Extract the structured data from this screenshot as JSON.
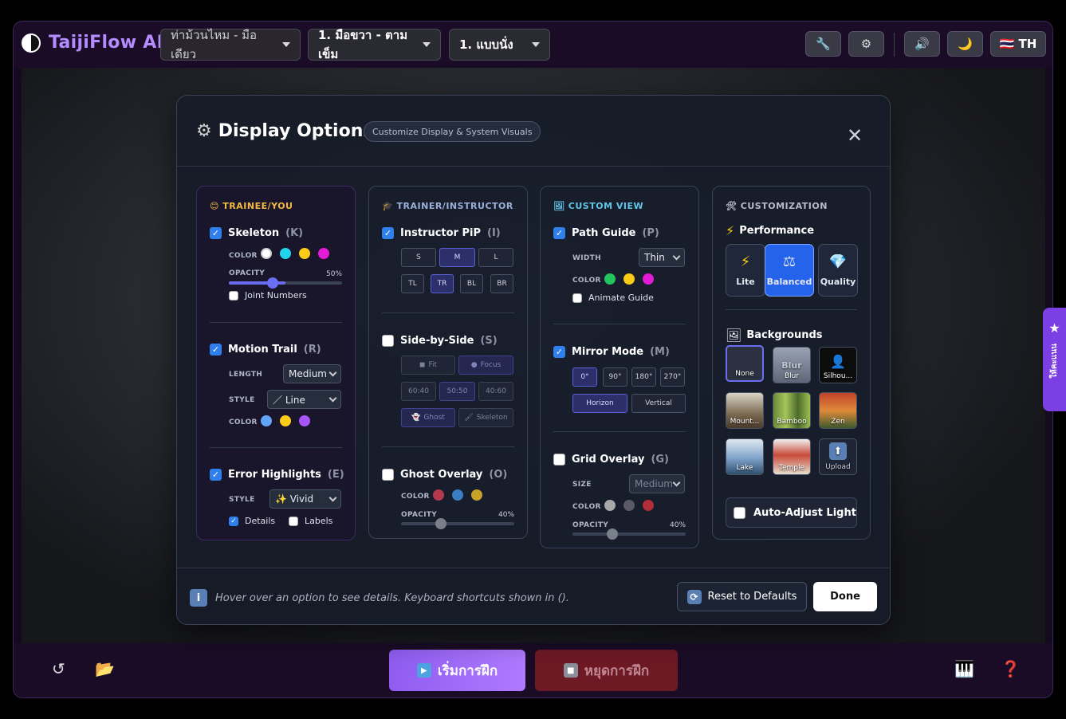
{
  "app": {
    "title": "TaijiFlow AI",
    "dropdowns": [
      "ท่าม้วนไหม - มือเดียว",
      "1. มือขวา - ตามเข็ม",
      "1. แบบนั่ง"
    ],
    "lang": "🇹🇭 TH",
    "toolbar_icons": [
      "wrench-icon",
      "gear-icon",
      "speaker-icon",
      "moon-icon"
    ]
  },
  "modal": {
    "title": "Display Options",
    "subtitle": "Customize Display & System Visuals",
    "close": "✕",
    "footer_hint": "Hover over an option to see details. Keyboard shortcuts shown in ().",
    "reset": "Reset to Defaults",
    "done": "Done"
  },
  "trainee": {
    "header": "TRAINEE/YOU",
    "skeleton": {
      "label": "Skeleton",
      "key": "(K)",
      "checked": true,
      "color_label": "COLOR",
      "colors": [
        "#ffffff",
        "#22d3ee",
        "#facc15",
        "#e11bd6"
      ],
      "opacity_label": "OPACITY",
      "opacity": "50%",
      "joint_numbers": "Joint Numbers"
    },
    "motion_trail": {
      "label": "Motion Trail",
      "key": "(R)",
      "checked": true,
      "length_label": "LENGTH",
      "length": "Medium",
      "style_label": "STYLE",
      "style": "／ Line",
      "color_label": "COLOR",
      "colors": [
        "#60a5fa",
        "#facc15",
        "#a855f7"
      ]
    },
    "error_highlights": {
      "label": "Error Highlights",
      "key": "(E)",
      "checked": true,
      "style_label": "STYLE",
      "style": "✨ Vivid",
      "details": "Details",
      "labels": "Labels"
    }
  },
  "trainer": {
    "header": "TRAINER/INSTRUCTOR",
    "pip": {
      "label": "Instructor PiP",
      "key": "(I)",
      "sizes": [
        "S",
        "M",
        "L"
      ],
      "positions": [
        "TL",
        "TR",
        "BL",
        "BR"
      ]
    },
    "side_by_side": {
      "label": "Side-by-Side",
      "key": "(S)",
      "modes": [
        "Fit",
        "Focus"
      ],
      "ratios": [
        "60:40",
        "50:50",
        "40:60"
      ],
      "views": [
        "Ghost",
        "Skeleton"
      ]
    },
    "ghost_overlay": {
      "label": "Ghost Overlay",
      "key": "(O)",
      "color_label": "COLOR",
      "colors": [
        "#b33a4e",
        "#3a7fc4",
        "#c9a22a"
      ],
      "opacity_label": "OPACITY",
      "opacity": "40%"
    }
  },
  "custom_view": {
    "header": "CUSTOM VIEW",
    "path_guide": {
      "label": "Path Guide",
      "key": "(P)",
      "width_label": "WIDTH",
      "width": "Thin",
      "color_label": "COLOR",
      "colors": [
        "#22c55e",
        "#facc15",
        "#e11bd6"
      ],
      "animate": "Animate Guide"
    },
    "mirror_mode": {
      "label": "Mirror Mode",
      "key": "(M)",
      "angles": [
        "0°",
        "90°",
        "180°",
        "270°"
      ],
      "axes": [
        "Horizon",
        "Vertical"
      ]
    },
    "grid_overlay": {
      "label": "Grid Overlay",
      "key": "(G)",
      "size_label": "SIZE",
      "size": "Medium",
      "color_label": "COLOR",
      "colors": [
        "#a8a8a8",
        "#5a5a66",
        "#b32d3a"
      ],
      "opacity_label": "OPACITY",
      "opacity": "40%"
    }
  },
  "customization": {
    "header": "CUSTOMIZATION",
    "performance_label": "Performance",
    "performance": [
      "Lite",
      "Balanced",
      "Quality"
    ],
    "backgrounds_label": "Backgrounds",
    "backgrounds": [
      "None",
      "Blur",
      "Silhou...",
      "Mount...",
      "Bamboo",
      "Zen",
      "Lake",
      "Temple",
      "Upload"
    ],
    "blur_overlay": "Blur",
    "auto_adjust": "Auto-Adjust Light"
  },
  "bottom": {
    "start": "เริ่มการฝึก",
    "stop": "หยุดการฝึก",
    "side_tab": "ให้คะแนน"
  },
  "colors": {
    "accent": "#8f5cf0",
    "primary": "#2563eb",
    "danger": "#6e1a25"
  }
}
